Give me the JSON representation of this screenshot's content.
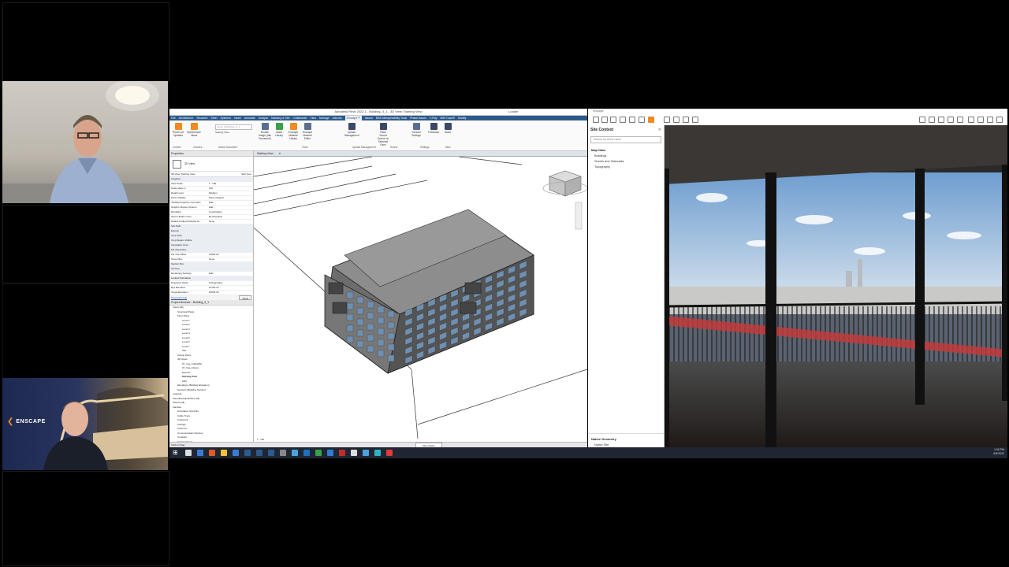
{
  "revit": {
    "window_title": "Autodesk Revit 2022.1 - Building_3_1 - 3D View: Starting View",
    "user": "Loader",
    "tabs": [
      "File",
      "Architecture",
      "Structure",
      "Steel",
      "Systems",
      "Insert",
      "Annotate",
      "Analyze",
      "Massing & Site",
      "Collaborate",
      "View",
      "Manage",
      "Add-Ins",
      "Enscape™",
      "Issues",
      "BIM Interoperability Tools",
      "Phase issues",
      "V-Ray",
      "BIM Trace®",
      "Modify"
    ],
    "active_tab": "Enscape™",
    "ribbon": {
      "buttons": [
        "Fixed Live Updates",
        "Synchronize Views",
        "Render Image (Idle Document)",
        "Asset Library",
        "Enscape Material Library",
        "Enscape Material Editor",
        "Upload Management",
        "Place Sound Source on Selected Face",
        "General Settings",
        "Feedback",
        "About"
      ],
      "view_selector_placeholder": "Name of Building_3_1",
      "view_selector_value": "Starting View",
      "groups": [
        "Control",
        "Camera",
        "Active Document",
        "Tools",
        "Upload Management",
        "Sound",
        "Settings",
        "Misc"
      ]
    },
    "properties": {
      "header": "Properties",
      "type": "3D View",
      "instance": "3D View: Starting View",
      "edit_type": "Edit Type",
      "rows": [
        [
          "Graphics",
          ""
        ],
        [
          "View Scale",
          "1 : 100"
        ],
        [
          "Scale Value 1:",
          "100"
        ],
        [
          "Detail Level",
          "Medium"
        ],
        [
          "Parts Visibility",
          "Show Original"
        ],
        [
          "Visibility/Graphics Overrides",
          "Edit..."
        ],
        [
          "Graphic Display Options",
          "Edit..."
        ],
        [
          "Discipline",
          "Coordination"
        ],
        [
          "Show Hidden Lines",
          "By Discipline"
        ],
        [
          "Default Analysis Display St...",
          "None"
        ],
        [
          "Sun Path",
          ""
        ],
        [
          "Extents",
          ""
        ],
        [
          "Crop View",
          ""
        ],
        [
          "Crop Region Visible",
          ""
        ],
        [
          "Annotation Crop",
          ""
        ],
        [
          "Far Clip Active",
          ""
        ],
        [
          "Far Clip Offset",
          "10660.00"
        ],
        [
          "Scope Box",
          "None"
        ],
        [
          "Section Box",
          ""
        ],
        [
          "Camera",
          ""
        ],
        [
          "Rendering Settings",
          "Edit..."
        ],
        [
          "Locked Orientation",
          ""
        ],
        [
          "Projection Mode",
          "Orthographic"
        ],
        [
          "Eye Elevation",
          "10750.15"
        ],
        [
          "Target Elevation",
          "10645.39"
        ]
      ],
      "help": "Properties help",
      "apply": "Apply"
    },
    "browser": {
      "header": "Project Browser - Building_3_1",
      "items": [
        "Views (all)",
        "Structural Plans",
        "Floor Plans",
        "Level 1",
        "Level 2",
        "Level 3",
        "Level 4",
        "Level 5",
        "Level 6",
        "Level 7",
        "Site",
        "Ceiling Plans",
        "3D Views",
        "07_Img_CoffeeBar",
        "07_Img_Library",
        "Exterior",
        "Starting View",
        "{3D}",
        "Elevations (Building Elevation)",
        "Sections (Building Section)",
        "Legends",
        "Schedules/Quantities (all)",
        "Sheets (all)",
        "Families",
        "Annotation Symbols",
        "Cable Trays",
        "Casework",
        "Ceilings",
        "Columns",
        "Communication Devices",
        "Conduits",
        "Curtain Panels"
      ]
    },
    "view_tab": "Starting View",
    "view_scale": "1 : 100",
    "status_text": "Click to Drag",
    "model_label": "Main Model"
  },
  "enscape": {
    "window_title": "Enscape",
    "site_context": {
      "title": "Site Context",
      "search_placeholder": "Search by street name",
      "section_map": "Map Data",
      "items": [
        "Buildings",
        "Streets and Sidewalks",
        "Topography"
      ],
      "section_native": "Native Geometry",
      "native_items": [
        "Native Site"
      ]
    }
  },
  "webcams": {
    "brand_label": "ENSCAPE"
  },
  "taskbar": {
    "time": "1:06 PM",
    "date": "8/9/2022"
  },
  "colors": {
    "revit_blue": "#2c5a8c",
    "enscape_orange": "#f08a24",
    "taskbar": "#1f2633"
  }
}
